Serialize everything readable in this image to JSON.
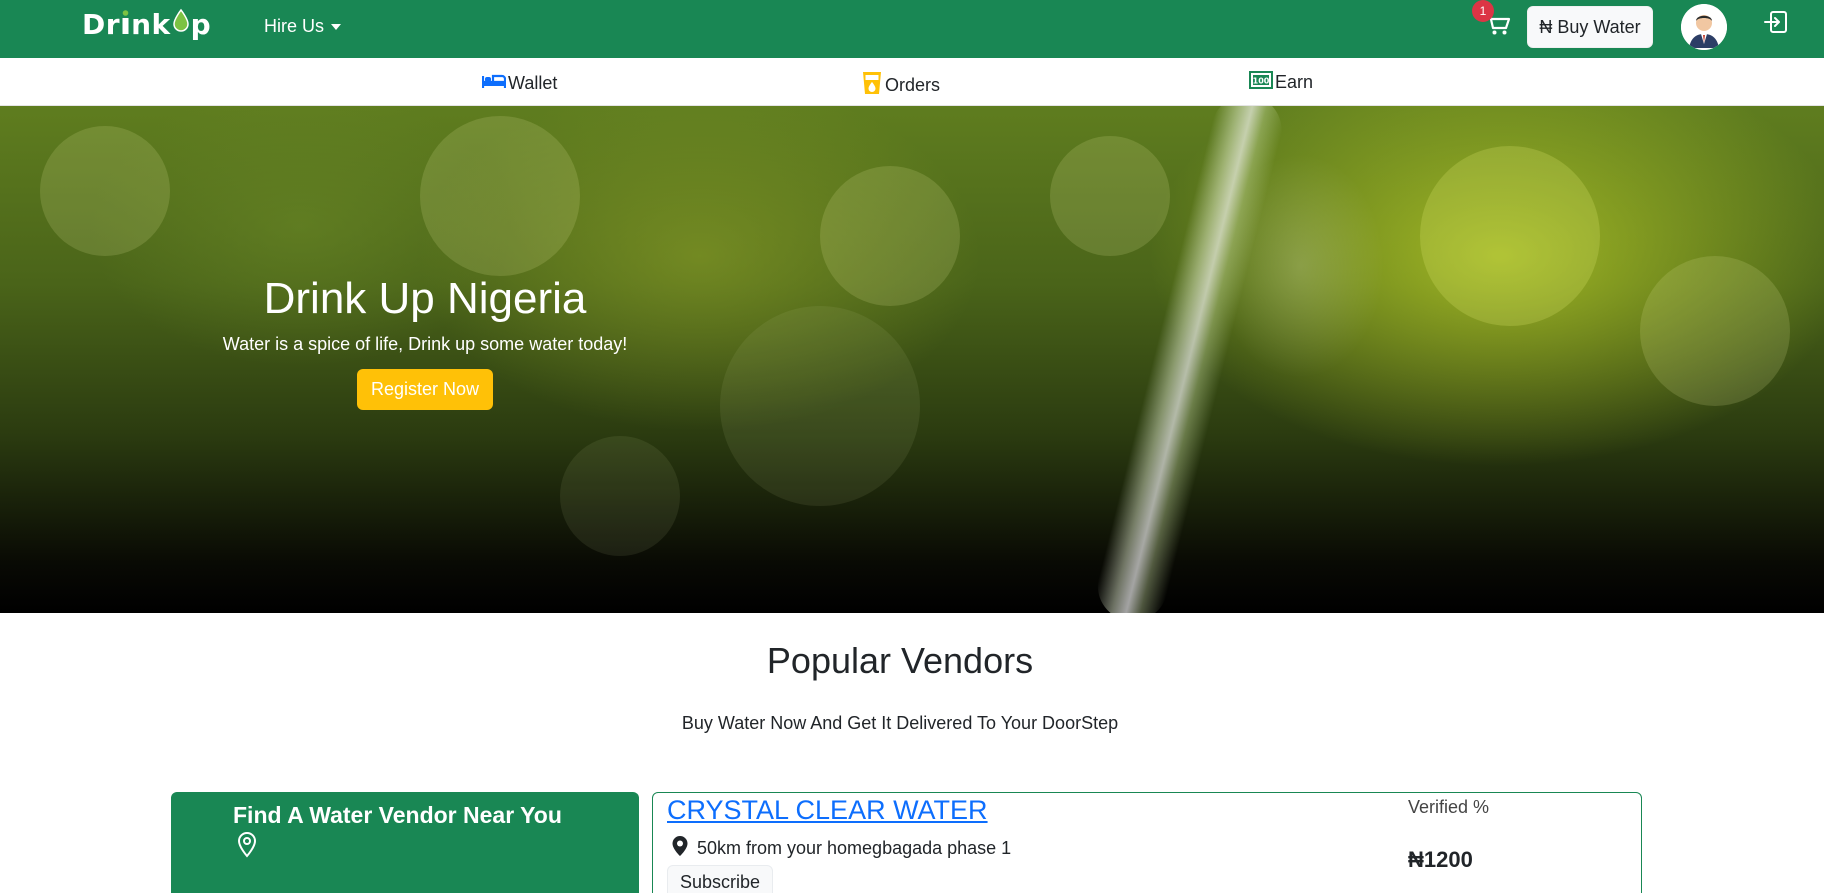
{
  "topnav": {
    "logo_text_1": "Dr",
    "logo_text_2": "nk",
    "logo_text_3": "p",
    "hire_label": "Hire Us",
    "cart_count": "1",
    "buy_label": "₦ Buy Water",
    "colors": {
      "brand": "#198754",
      "badge": "#dc3545"
    }
  },
  "subnav": {
    "items": [
      {
        "label": "Wallet",
        "icon": "bed-icon",
        "color": "#0d6efd"
      },
      {
        "label": "Orders",
        "icon": "cup-icon",
        "color": "#ffc107"
      },
      {
        "label": "Earn",
        "icon": "cash-icon",
        "color": "#198754"
      }
    ]
  },
  "hero": {
    "title": "Drink Up Nigeria",
    "subtitle": "Water is a spice of life, Drink up some water today!",
    "cta": "Register Now",
    "cta_color": "#ffc107"
  },
  "vendors": {
    "title": "Popular Vendors",
    "subtitle": "Buy Water Now And Get It Delivered To Your DoorStep",
    "finder_title": "Find A Water Vendor Near You",
    "list": [
      {
        "name": "CRYSTAL CLEAR WATER",
        "distance": "50km from your homegbagada phase 1",
        "subscribe": "Subscribe",
        "verified": "Verified %",
        "price": "₦1200"
      }
    ]
  }
}
